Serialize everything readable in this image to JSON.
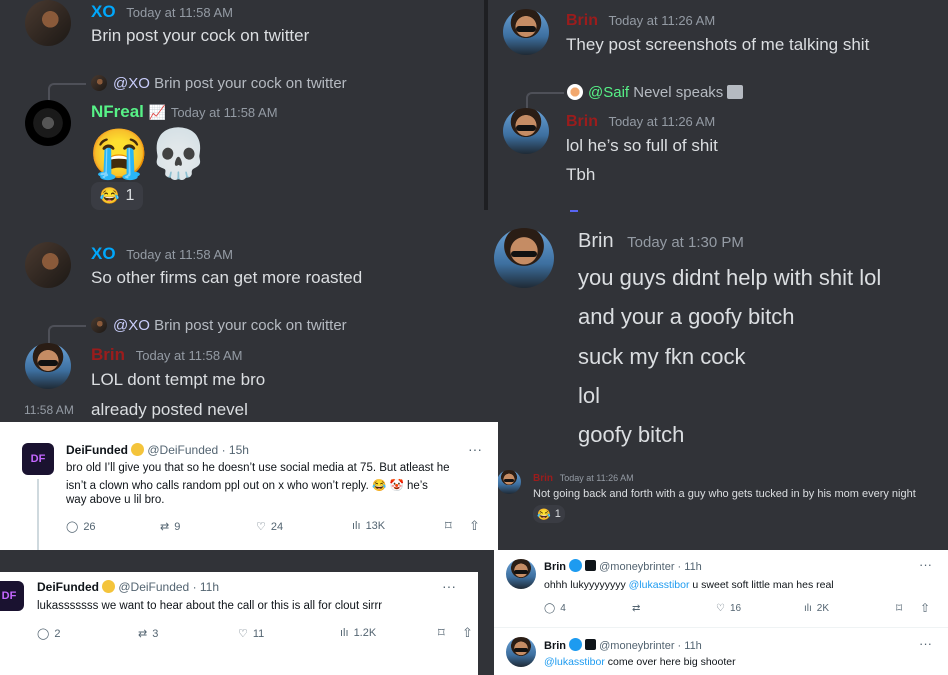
{
  "left_chat": {
    "m1": {
      "name": "XO",
      "time": "Today at 11:58 AM",
      "text": "Brin post your cock on twitter"
    },
    "m2": {
      "reply_mention": "@XO",
      "reply_text": "Brin post your cock on twitter",
      "name": "NFreal",
      "time": "Today at 11:58 AM",
      "emoji": "😭💀",
      "reaction_emoji": "😂",
      "reaction_count": "1"
    },
    "m3": {
      "name": "XO",
      "time": "Today at 11:58 AM",
      "text": "So other firms can get more roasted"
    },
    "m4": {
      "reply_mention": "@XO",
      "reply_text": "Brin post your cock on twitter",
      "name": "Brin",
      "time": "Today at 11:58 AM",
      "text": "LOL dont tempt me bro",
      "side_time": "11:58 AM",
      "text2": "already posted nevel"
    }
  },
  "right_chat": {
    "m1": {
      "name": "Brin",
      "time": "Today at 11:26 AM",
      "text": "They post screenshots of me talking shit"
    },
    "m2": {
      "reply_mention": "@Saif",
      "reply_text": "Nevel speaks",
      "name": "Brin",
      "time": "Today at 11:26 AM",
      "text": "lol he’s so full of shit",
      "text2": "Tbh"
    }
  },
  "big_chat": {
    "name": "Brin",
    "time": "Today at 1:30 PM",
    "lines": [
      "you guys didnt help with shit lol",
      "and your a goofy bitch",
      "suck my fkn cock",
      "lol",
      "goofy bitch"
    ]
  },
  "small_chat": {
    "name": "Brin",
    "time": "Today at 11:26 AM",
    "text": "Not going back and forth with a guy who gets tucked in by his mom every night",
    "reaction_emoji": "😂",
    "reaction_count": "1"
  },
  "tweet1": {
    "avatar": "DF",
    "name": "DeiFunded",
    "handle": "@DeiFunded · 15h",
    "text1": "bro old I’ll give you that so he doesn’t use social media at 75. But atleast he",
    "text2": "isn’t a clown who calls random ppl out on x who won’t reply. 😂 🤡  he’s",
    "text3": "way above u lil bro.",
    "replies": "26",
    "retweets": "9",
    "likes": "24",
    "views": "13K",
    "more": "···"
  },
  "tweet2": {
    "avatar": "DF",
    "name": "DeiFunded",
    "handle": "@DeiFunded · 11h",
    "text": "lukasssssss we want to hear about the call or this is all for clout sirrr",
    "replies": "2",
    "retweets": "3",
    "likes": "11",
    "views": "1.2K",
    "more": "···"
  },
  "tweet3": {
    "name": "Brin",
    "handle": "@moneybrinter · 11h",
    "text_pre": "ohhh lukyyyyyyyy ",
    "mention": "@lukasstibor",
    "text_post": " u sweet soft little man hes real",
    "replies": "4",
    "likes": "16",
    "views": "2K",
    "more": "···"
  },
  "tweet4": {
    "name": "Brin",
    "handle": "@moneybrinter · 11h",
    "mention": "@lukasstibor",
    "text_post": " come over here big shooter",
    "more": "···"
  },
  "colors": {
    "discord_bg": "#313338",
    "brin_red": "#9b1c1c",
    "xo_blue": "#00a8fc",
    "nfreal_green": "#57f287",
    "mention": "#1d9bf0"
  }
}
